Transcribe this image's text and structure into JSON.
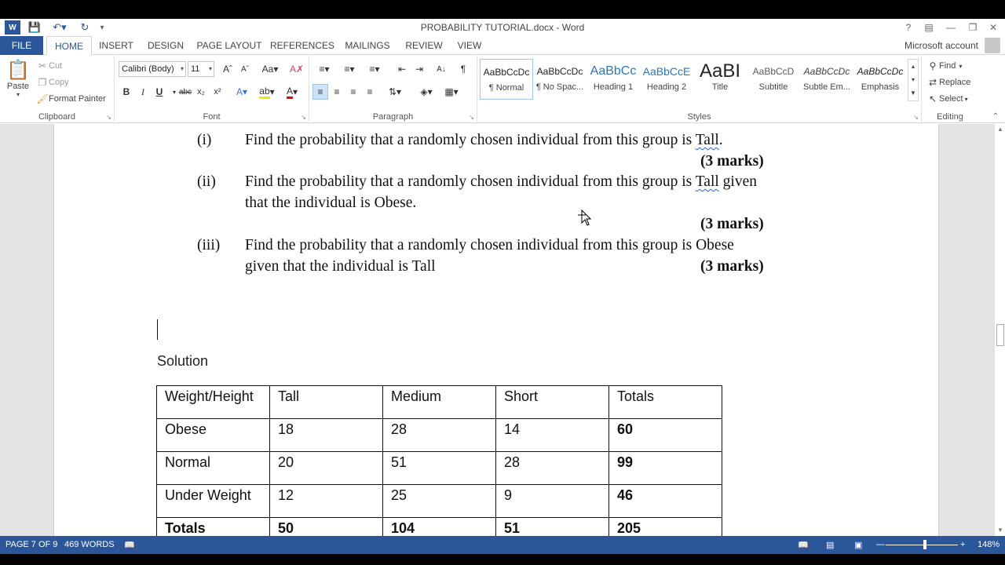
{
  "window": {
    "title": "PROBABILITY TUTORIAL.docx - Word",
    "account": "Microsoft account",
    "help": "?"
  },
  "tabs": [
    "FILE",
    "HOME",
    "INSERT",
    "DESIGN",
    "PAGE LAYOUT",
    "REFERENCES",
    "MAILINGS",
    "REVIEW",
    "VIEW"
  ],
  "ribbon": {
    "clipboard": {
      "paste": "Paste",
      "cut": "Cut",
      "copy": "Copy",
      "format_painter": "Format Painter",
      "label": "Clipboard"
    },
    "font": {
      "name": "Calibri (Body)",
      "size": "11",
      "label": "Font"
    },
    "paragraph": {
      "label": "Paragraph"
    },
    "styles": {
      "label": "Styles",
      "items": [
        {
          "sample": "AaBbCcDc",
          "name": "¶ Normal"
        },
        {
          "sample": "AaBbCcDc",
          "name": "¶ No Spac..."
        },
        {
          "sample": "AaBbCc",
          "name": "Heading 1"
        },
        {
          "sample": "AaBbCcE",
          "name": "Heading 2"
        },
        {
          "sample": "AaBI",
          "name": "Title"
        },
        {
          "sample": "AaBbCcD",
          "name": "Subtitle"
        },
        {
          "sample": "AaBbCcDc",
          "name": "Subtle Em..."
        },
        {
          "sample": "AaBbCcDc",
          "name": "Emphasis"
        }
      ]
    },
    "editing": {
      "find": "Find",
      "replace": "Replace",
      "select": "Select",
      "label": "Editing"
    }
  },
  "document": {
    "q1": {
      "num": "(i)",
      "pre": "Find the probability that a randomly chosen individual from this group is ",
      "word": "Tall",
      "post": ".",
      "marks": "(3 marks)"
    },
    "q2": {
      "num": "(ii)",
      "pre": "Find the probability that a randomly chosen individual from this group is ",
      "word": "Tall",
      "post": " given",
      "line2": "that the individual is Obese.",
      "marks": "(3 marks)"
    },
    "q3": {
      "num": "(iii)",
      "line1": "Find the probability that a randomly chosen individual from this group is Obese",
      "line2": "given that the individual is Tall",
      "marks": "(3 marks)"
    },
    "solution": "Solution",
    "table": [
      [
        "Weight/Height",
        "Tall",
        "Medium",
        "Short",
        "Totals"
      ],
      [
        "Obese",
        "18",
        "28",
        "14",
        "60"
      ],
      [
        "Normal",
        "20",
        "51",
        "28",
        "99"
      ],
      [
        "Under Weight",
        "12",
        "25",
        "9",
        "46"
      ],
      [
        "Totals",
        "50",
        "104",
        "51",
        "205"
      ]
    ]
  },
  "status": {
    "page": "PAGE 7 OF 9",
    "words": "469 WORDS",
    "zoom": "148%",
    "zoom_level": 1.48
  },
  "colors": {
    "accent": "#2b579a"
  }
}
